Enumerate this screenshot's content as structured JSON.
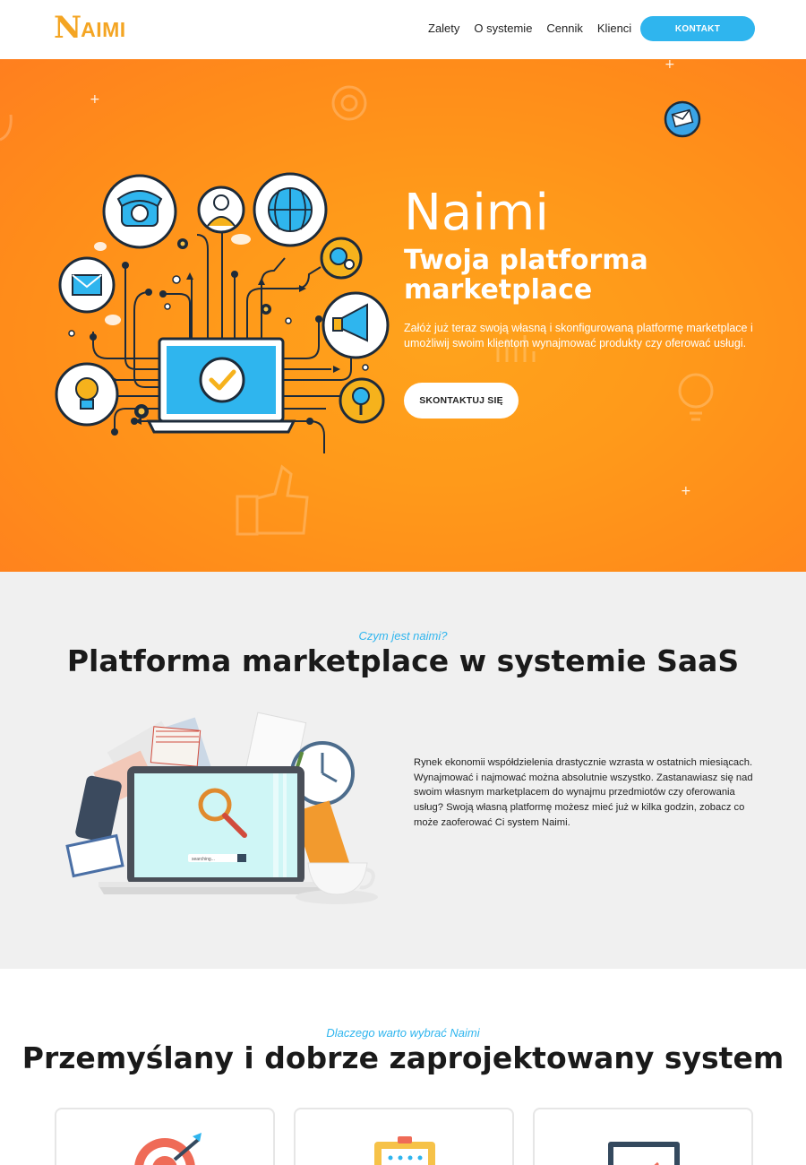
{
  "header": {
    "logo_text": "NAIMI",
    "nav": [
      "Zalety",
      "O systemie",
      "Cennik",
      "Klienci"
    ],
    "cta_label": "KONTAKT"
  },
  "hero": {
    "title": "Naimi",
    "subtitle": "Twoja platforma marketplace",
    "description": "Załóż już teraz swoją własną i skonfigurowaną platformę marketplace i umożliwij swoim klientom wynajmować produkty czy oferować usługi.",
    "button_label": "SKONTAKTUJ SIĘ"
  },
  "about": {
    "kicker": "Czym jest naimi?",
    "title": "Platforma marketplace w systemie SaaS",
    "text": "Rynek ekonomii współdzielenia drastycznie wzrasta w ostatnich miesiącach. Wynajmować i najmować można absolutnie wszystko. Zastanawiasz się nad swoim własnym marketplacem do wynajmu przedmiotów czy oferowania usług? Swoją własną platformę możesz mieć już w kilka godzin, zobacz co może zaoferować Ci system Naimi.",
    "search_placeholder": "searching..."
  },
  "why": {
    "kicker": "Dlaczego warto wybrać Naimi",
    "title": "Przemyślany i dobrze zaprojektowany system"
  },
  "colors": {
    "accent": "#2fb5ee",
    "hero_orange": "#ff9a1a",
    "logo": "#f4a523"
  }
}
